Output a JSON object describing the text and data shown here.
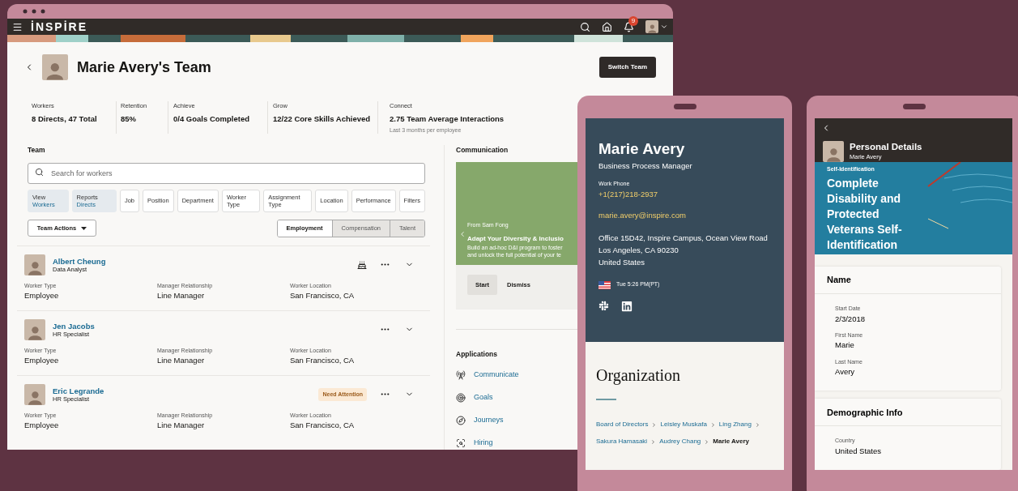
{
  "desktop": {
    "brand": "İNSPİRE",
    "notification_count": "9",
    "title": "Marie Avery's Team",
    "switch_button": "Switch Team",
    "metrics": [
      {
        "label": "Workers",
        "value": "8 Directs, 47 Total"
      },
      {
        "label": "Retention",
        "value": "85%"
      },
      {
        "label": "Achieve",
        "value": "0/4 Goals Completed"
      },
      {
        "label": "Grow",
        "value": "12/22 Core Skills Achieved"
      },
      {
        "label": "Connect",
        "value": "2.75 Team Average Interactions",
        "note": "Last 3 months per employee"
      }
    ],
    "team": {
      "heading": "Team",
      "search": {
        "placeholder": "Search for workers"
      },
      "chips": [
        {
          "label": "View",
          "value": "Workers",
          "selected": true
        },
        {
          "label": "Reports",
          "value": "Directs",
          "selected": true
        },
        {
          "label": "Job",
          "selected": false
        },
        {
          "label": "Position",
          "selected": false
        },
        {
          "label": "Department",
          "selected": false
        },
        {
          "label": "Worker Type",
          "selected": false
        },
        {
          "label": "Assignment Type",
          "selected": false
        },
        {
          "label": "Location",
          "selected": false
        },
        {
          "label": "Performance",
          "selected": false
        },
        {
          "label": "Filters",
          "selected": false
        }
      ],
      "actions": "Team Actions",
      "tabs": [
        {
          "label": "Employment",
          "selected": true
        },
        {
          "label": "Compensation",
          "selected": false
        },
        {
          "label": "Talent",
          "selected": false
        }
      ],
      "rows": [
        {
          "name": "Albert Cheung",
          "job": "Data Analyst",
          "recognized": true,
          "fields": [
            {
              "label": "Worker Type",
              "value": "Employee"
            },
            {
              "label": "Manager Relationship",
              "value": "Line Manager"
            },
            {
              "label": "Worker Location",
              "value": "San Francisco, CA"
            }
          ]
        },
        {
          "name": "Jen Jacobs",
          "job": "HR Specialist",
          "recognized": false,
          "fields": [
            {
              "label": "Worker Type",
              "value": "Employee"
            },
            {
              "label": "Manager Relationship",
              "value": "Line Manager"
            },
            {
              "label": "Worker Location",
              "value": "San Francisco, CA"
            }
          ]
        },
        {
          "name": "Eric Legrande",
          "job": "HR Specialist",
          "recognized": false,
          "badge": "Need Attention",
          "fields": [
            {
              "label": "Worker Type",
              "value": "Employee"
            },
            {
              "label": "Manager Relationship",
              "value": "Line Manager"
            },
            {
              "label": "Worker Location",
              "value": "San Francisco, CA"
            }
          ]
        }
      ]
    },
    "communication": {
      "heading": "Communication",
      "from": "From Sam Fong",
      "title": "Adapt Your Diversity & Inclusio",
      "lines": [
        "Build an ad-hoc D&I program to foster",
        "and unlock the full potential of your te"
      ],
      "buttons": [
        {
          "label": "Start",
          "kind": "primary"
        },
        {
          "label": "Dismiss",
          "kind": "plain"
        }
      ]
    },
    "applications": {
      "heading": "Applications",
      "items": [
        {
          "label": "Communicate",
          "kind": "communicate"
        },
        {
          "label": "Goals",
          "kind": "goals"
        },
        {
          "label": "Journeys",
          "kind": "journeys"
        },
        {
          "label": "Hiring",
          "kind": "hiring"
        }
      ]
    }
  },
  "profile_phone": {
    "name": "Marie Avery",
    "title": "Business Process Manager",
    "phone_label": "Work Phone",
    "phone": "+1(217)218-2937",
    "email": "marie.avery@inspire.com",
    "address": [
      "Office 15D42, Inspire Campus, Ocean View Road",
      "Los Angeles, CA 90230",
      "United States"
    ],
    "local_time": "Tue 5:26 PM(PT)",
    "org_heading": "Organization",
    "breadcrumb": [
      {
        "label": "Board of Directors",
        "current": false
      },
      {
        "label": "Leisley Muskafa",
        "current": false
      },
      {
        "label": "Ling Zhang",
        "current": false
      },
      {
        "label": "Sakura Hamasaki",
        "current": false
      },
      {
        "label": "Audrey Chang",
        "current": false
      },
      {
        "label": "Marie Avery",
        "current": true
      }
    ]
  },
  "details_phone": {
    "title": "Personal Details",
    "subtitle": "Marie Avery",
    "eyebrow": "Self-Identification",
    "headline": "Complete Disability and Protected Veterans Self-Identification",
    "sections": [
      {
        "title": "Name",
        "fields": [
          {
            "label": "Start Date",
            "value": "2/3/2018"
          },
          {
            "label": "First Name",
            "value": "Marie"
          },
          {
            "label": "Last Name",
            "value": "Avery"
          }
        ]
      },
      {
        "title": "Demographic Info",
        "fields": [
          {
            "label": "Country",
            "value": "United States"
          }
        ]
      }
    ]
  }
}
